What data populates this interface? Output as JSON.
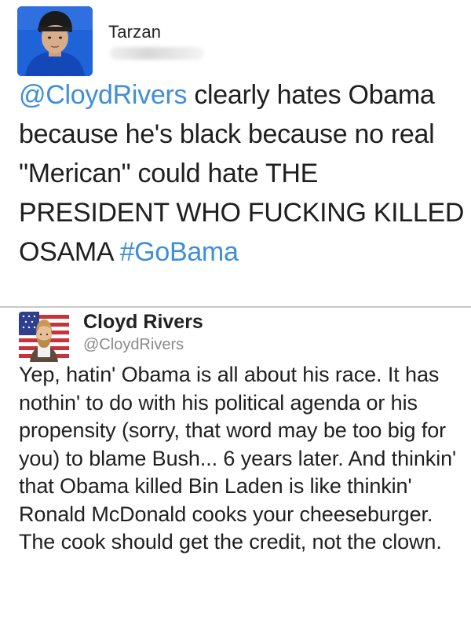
{
  "tweet1": {
    "author_name": "Tarzan",
    "mention": "@CloydRivers",
    "text_after_mention": " clearly hates Obama because he's black because no real \"Merican\" could hate THE PRESIDENT WHO FUCKING KILLED OSAMA ",
    "hashtag": "#GoBama"
  },
  "tweet2": {
    "author_name": "Cloyd Rivers",
    "handle": "@CloydRivers",
    "text": "Yep, hatin' Obama is all about his race. It has nothin' to do with his political agenda or his propensity (sorry, that word may be too big for you) to blame Bush... 6 years later. And thinkin' that Obama killed Bin Laden is like thinkin' Ronald McDonald cooks your cheeseburger. The cook should get the credit, not the clown."
  },
  "colors": {
    "link": "#3f8ed6",
    "text": "#1f1f1f",
    "handle": "#8a8a8a",
    "divider": "#c9c9c9"
  }
}
